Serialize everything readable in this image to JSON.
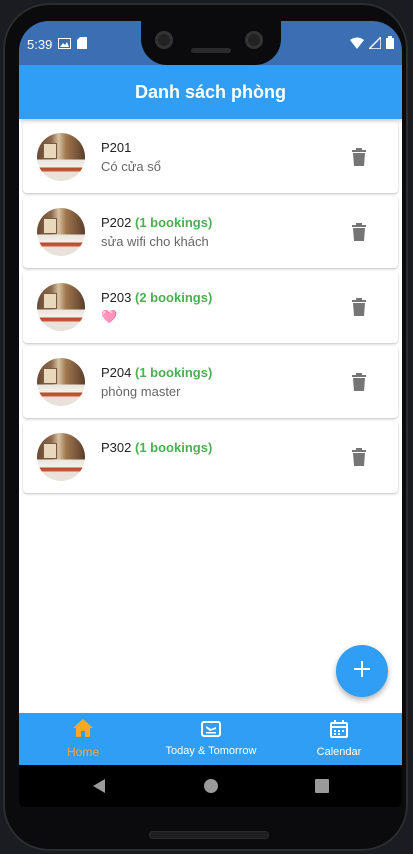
{
  "status_bar": {
    "time": "5:39"
  },
  "appbar": {
    "title": "Danh sách phòng"
  },
  "rooms": [
    {
      "name": "P201",
      "bookings": "",
      "note": "Có cửa sổ"
    },
    {
      "name": "P202",
      "bookings": "(1 bookings)",
      "note": "sửa wifi cho khách"
    },
    {
      "name": "P203",
      "bookings": "(2 bookings)",
      "note": "🩷"
    },
    {
      "name": "P204",
      "bookings": "(1 bookings)",
      "note": "phòng master"
    },
    {
      "name": "P302",
      "bookings": "(1 bookings)",
      "note": ""
    }
  ],
  "bottom_nav": {
    "items": [
      {
        "label": "Home",
        "icon": "home-icon",
        "active": true
      },
      {
        "label": "Today & Tomorrow",
        "icon": "flight-land-icon",
        "active": false
      },
      {
        "label": "Calendar",
        "icon": "calendar-icon",
        "active": false
      }
    ]
  },
  "colors": {
    "primary": "#2f9ef4",
    "bookings_green": "#4caf50",
    "active_nav": "#ffa726",
    "trash_grey": "#757575"
  }
}
